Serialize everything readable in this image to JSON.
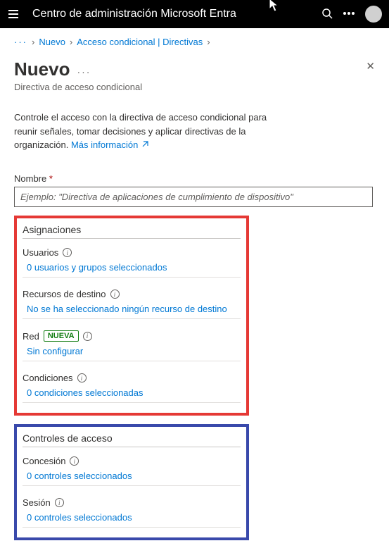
{
  "topbar": {
    "title": "Centro de administración Microsoft Entra"
  },
  "breadcrumb": {
    "items": [
      "Nuevo",
      "Acceso condicional | Directivas"
    ]
  },
  "header": {
    "title": "Nuevo",
    "subtitle": "Directiva de acceso condicional"
  },
  "description": {
    "text": "Controle el acceso con la directiva de acceso condicional para reunir señales, tomar decisiones y aplicar directivas de la organización. ",
    "learn_more": "Más información"
  },
  "name_field": {
    "label": "Nombre",
    "placeholder": "Ejemplo: \"Directiva de aplicaciones de cumplimiento de dispositivo\""
  },
  "assignments": {
    "title": "Asignaciones",
    "users": {
      "label": "Usuarios",
      "value": "0 usuarios y grupos seleccionados"
    },
    "resources": {
      "label": "Recursos de destino",
      "value": "No se ha seleccionado ningún recurso de destino"
    },
    "network": {
      "label": "Red",
      "badge": "NUEVA",
      "value": "Sin configurar"
    },
    "conditions": {
      "label": "Condiciones",
      "value": "0 condiciones seleccionadas"
    }
  },
  "access_controls": {
    "title": "Controles de acceso",
    "grant": {
      "label": "Concesión",
      "value": "0 controles seleccionados"
    },
    "session": {
      "label": "Sesión",
      "value": "0 controles seleccionados"
    }
  }
}
